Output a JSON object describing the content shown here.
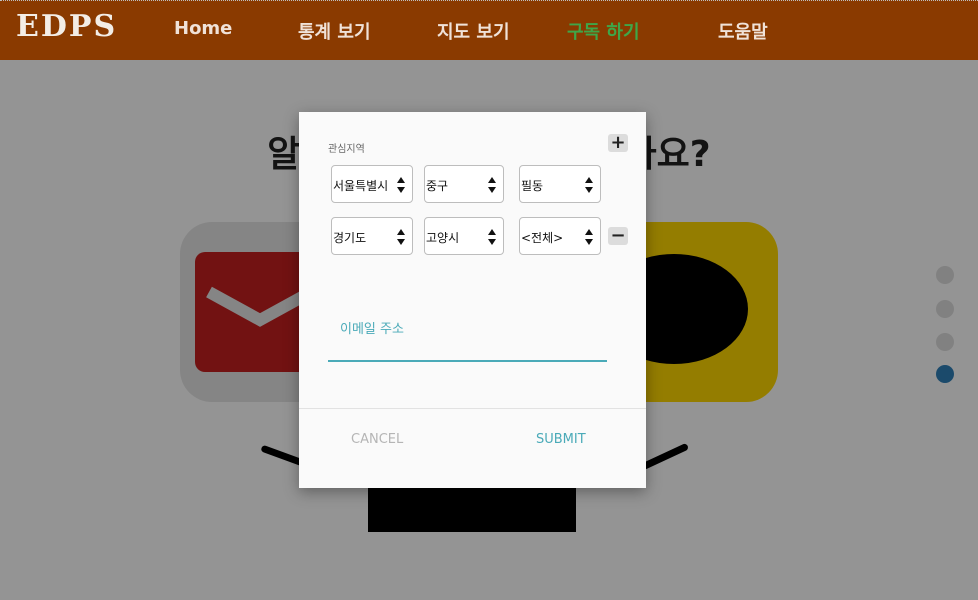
{
  "navbar": {
    "brand": "EDPS",
    "links": [
      "Home",
      "통계 보기",
      "지도 보기",
      "구독 하기",
      "도움말"
    ],
    "active_index": 3,
    "background_color": "#8a3a00",
    "active_color": "#3fa648"
  },
  "page": {
    "title": "알림을 어디로 받으시겠나요?",
    "cards": [
      {
        "name": "email",
        "icon": "mail-envelope-icon",
        "color": "#c41f1f"
      },
      {
        "name": "kakao",
        "icon": "chat-bubble-icon",
        "color": "#ffd800"
      }
    ],
    "pagination": {
      "count": 4,
      "active_index": 3,
      "active_color": "#2f80b8"
    }
  },
  "modal": {
    "region_label": "관심지역",
    "add_icon": "plus-icon",
    "remove_icon": "minus-icon",
    "regions": [
      {
        "sido": "서울특별시",
        "sigungu": "중구",
        "dong": "필동"
      },
      {
        "sido": "경기도",
        "sigungu": "고양시",
        "dong": "<전체>"
      }
    ],
    "email_placeholder": "이메일 주소",
    "cancel_label": "CANCEL",
    "submit_label": "SUBMIT",
    "accent_color": "#4aaab8"
  }
}
